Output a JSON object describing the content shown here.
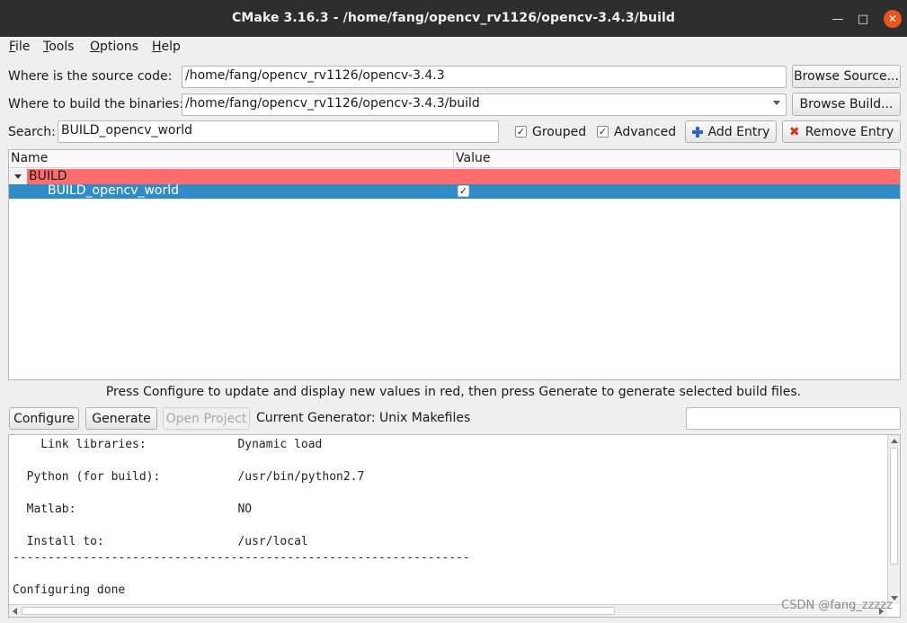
{
  "window": {
    "title": "CMake 3.16.3 - /home/fang/opencv_rv1126/opencv-3.4.3/build",
    "min_icon": "minimize-icon",
    "max_icon": "maximize-icon",
    "close_icon": "close-icon"
  },
  "menu": {
    "file": {
      "underline": "F",
      "rest": "ile"
    },
    "tools": {
      "underline": "T",
      "rest": "ools"
    },
    "options": {
      "underline": "O",
      "rest": "ptions"
    },
    "help": {
      "underline": "H",
      "rest": "elp"
    }
  },
  "source": {
    "label": "Where is the source code:",
    "value": "/home/fang/opencv_rv1126/opencv-3.4.3",
    "browse_label": "Browse Source..."
  },
  "binaries": {
    "label": "Where to build the binaries:",
    "value": "/home/fang/opencv_rv1126/opencv-3.4.3/build",
    "browse_label": "Browse Build..."
  },
  "search": {
    "label": "Search:",
    "value": "BUILD_opencv_world"
  },
  "options_row": {
    "grouped_label": "Grouped",
    "grouped_checked": "✓",
    "advanced_label": "Advanced",
    "advanced_checked": "✓",
    "add_entry_label": "Add Entry",
    "remove_entry_label": "Remove Entry"
  },
  "tree": {
    "col_name": "Name",
    "col_value": "Value",
    "group_name": "BUILD",
    "item_name": "BUILD_opencv_world",
    "item_value": "✓",
    "group_color": "#ff6c6c",
    "selected_color": "#308cc6"
  },
  "info_text": "Press Configure to update and display new values in red, then press Generate to generate selected build files.",
  "actions": {
    "configure": "Configure",
    "generate": "Generate",
    "open_project": "Open Project",
    "generator_text": "Current Generator: Unix Makefiles"
  },
  "output": {
    "text": "    Link libraries:             Dynamic load\n\n  Python (for build):           /usr/bin/python2.7\n\n  Matlab:                       NO\n\n  Install to:                   /usr/local\n-----------------------------------------------------------------\n\nConfiguring done"
  },
  "watermark": "CSDN @fang_zzzzz"
}
